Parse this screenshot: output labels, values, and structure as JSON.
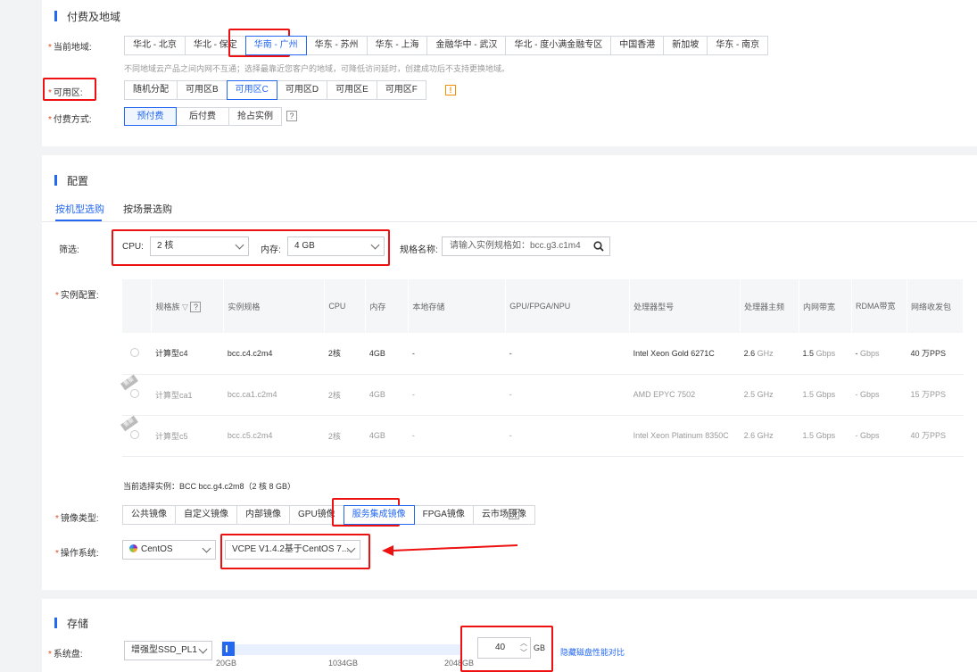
{
  "billing": {
    "title": "付费及地域",
    "region_label": "当前地域:",
    "regions": [
      "华北 - 北京",
      "华北 - 保定",
      "华南 - 广州",
      "华东 - 苏州",
      "华东 - 上海",
      "金融华中 - 武汉",
      "华北 - 度小满金融专区",
      "中国香港",
      "新加坡",
      "华东 - 南京"
    ],
    "region_selected": "华南 - 广州",
    "region_hint": "不同地域云产品之间内网不互通；选择最靠近您客户的地域，可降低访问延时，创建成功后不支持更换地域。",
    "zone_label": "可用区:",
    "zones": [
      "随机分配",
      "可用区B",
      "可用区C",
      "可用区D",
      "可用区E",
      "可用区F"
    ],
    "zone_selected": "可用区C",
    "pay_label": "付费方式:",
    "pay_options": [
      "预付费",
      "后付费",
      "抢占实例"
    ],
    "pay_selected": "预付费"
  },
  "config": {
    "title": "配置",
    "tabs": [
      "按机型选购",
      "按场景选购"
    ],
    "filter_label": "筛选:",
    "cpu_label": "CPU:",
    "cpu_value": "2 核",
    "mem_label": "内存:",
    "mem_value": "4 GB",
    "spec_label": "规格名称:",
    "spec_placeholder": "请输入实例规格如：bcc.g3.c1m4",
    "instance_label": "实例配置:",
    "columns": [
      "规格族",
      "实例规格",
      "CPU",
      "内存",
      "本地存储",
      "GPU/FPGA/NPU",
      "处理器型号",
      "处理器主频",
      "内网带宽",
      "RDMA带宽",
      "网络收发包"
    ],
    "rows": [
      {
        "family": "计算型c4",
        "spec": "bcc.c4.c2m4",
        "cpu": "2核",
        "mem": "4GB",
        "storage": "-",
        "gpu": "-",
        "processor": "Intel Xeon Gold 6271C",
        "freq": "2.6",
        "freq_unit": "GHz",
        "bw": "1.5",
        "bw_unit": "Gbps",
        "rdma": "-",
        "rdma_unit": "Gbps",
        "pps": "40 万PPS",
        "disabled": false,
        "ribbon": ""
      },
      {
        "family": "计算型ca1",
        "spec": "bcc.ca1.c2m4",
        "cpu": "2核",
        "mem": "4GB",
        "storage": "-",
        "gpu": "-",
        "processor": "AMD EPYC 7502",
        "freq": "2.5",
        "freq_unit": "GHz",
        "bw": "1.5",
        "bw_unit": "Gbps",
        "rdma": "-",
        "rdma_unit": "Gbps",
        "pps": "15 万PPS",
        "disabled": true,
        "ribbon": "售罄"
      },
      {
        "family": "计算型c5",
        "spec": "bcc.c5.c2m4",
        "cpu": "2核",
        "mem": "4GB",
        "storage": "-",
        "gpu": "-",
        "processor": "Intel Xeon Platinum 8350C",
        "freq": "2.6",
        "freq_unit": "GHz",
        "bw": "1.5",
        "bw_unit": "Gbps",
        "rdma": "-",
        "rdma_unit": "Gbps",
        "pps": "40 万PPS",
        "disabled": true,
        "ribbon": "售罄"
      }
    ],
    "current_selection": "当前选择实例：BCC bcc.g4.c2m8（2 核 8 GB）",
    "image_label": "镜像类型:",
    "image_types": [
      "公共镜像",
      "自定义镜像",
      "内部镜像",
      "GPU镜像",
      "服务集成镜像",
      "FPGA镜像",
      "云市场镜像"
    ],
    "image_selected": "服务集成镜像",
    "os_label": "操作系统:",
    "os_value": "CentOS",
    "os_version": "VCPE V1.4.2基于CentOS 7..."
  },
  "storage": {
    "title": "存储",
    "disk_label": "系统盘:",
    "disk_type": "增强型SSD_PL1",
    "disk_size": "40",
    "disk_unit": "GB",
    "ticks": [
      "20GB",
      "1034GB",
      "2048GB"
    ],
    "compare_link": "隐藏磁盘性能对比"
  },
  "colors": {
    "accent": "#2468f2",
    "annotation": "#ee1111",
    "warn": "#f39000"
  }
}
